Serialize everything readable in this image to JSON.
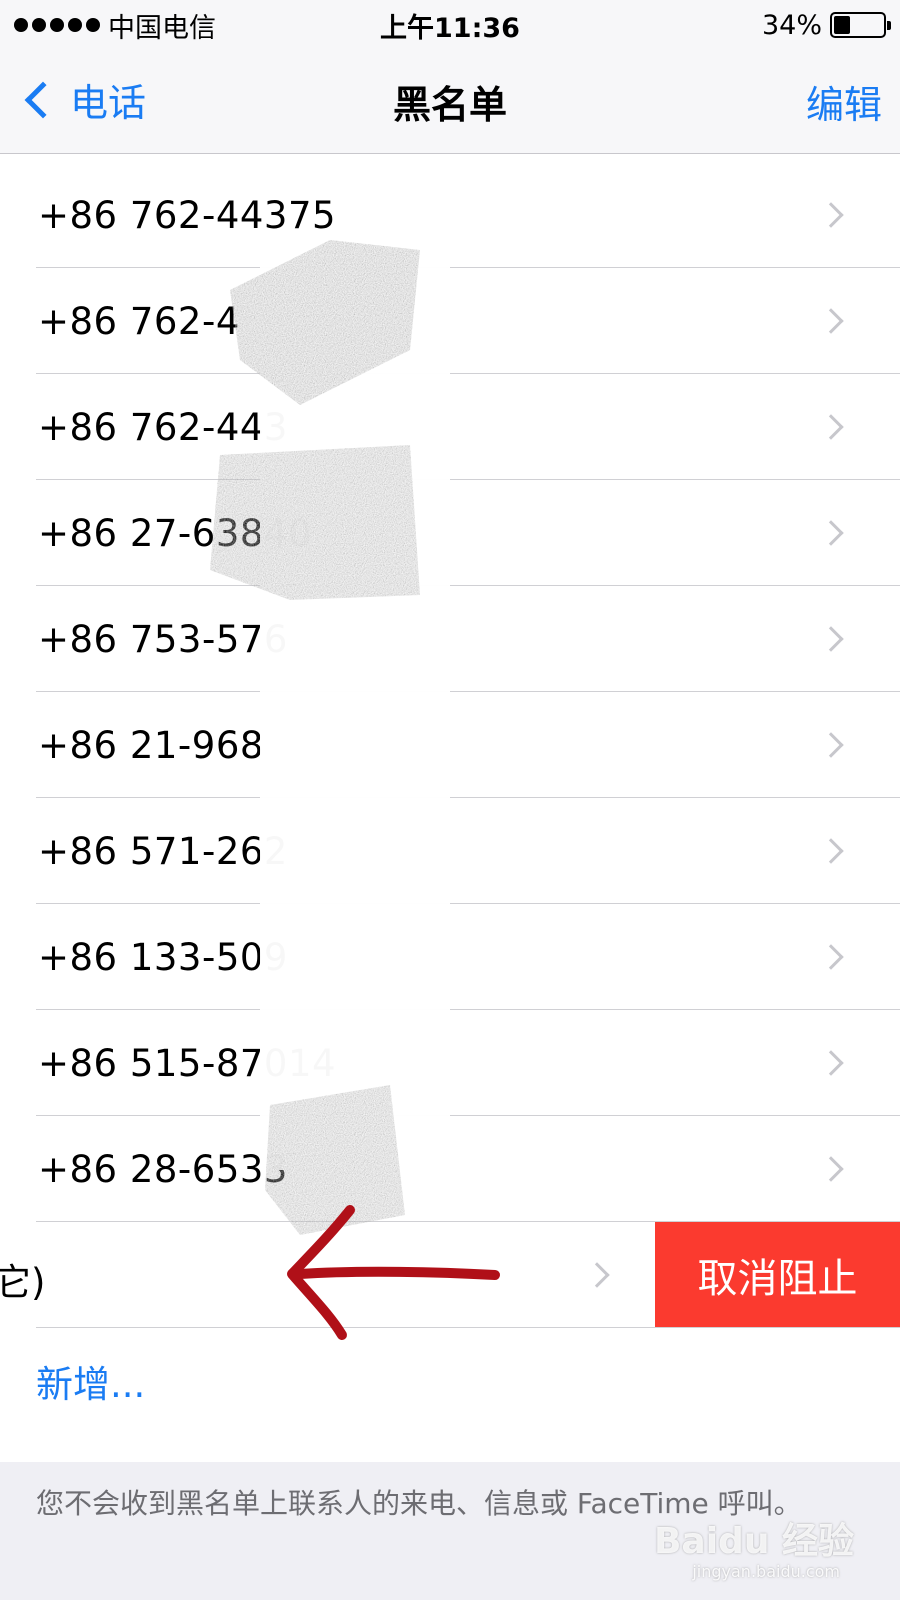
{
  "status_bar": {
    "carrier": "中国电信",
    "time": "上午11:36",
    "battery_percent": "34%",
    "battery_level": 0.34
  },
  "nav": {
    "back_label": "电话",
    "title": "黑名单",
    "edit_label": "编辑"
  },
  "blocked_numbers": [
    {
      "number": "+86 762-44375"
    },
    {
      "number": "+86 762-4"
    },
    {
      "number": "+86 762-443"
    },
    {
      "number": "+86 27-63840"
    },
    {
      "number": "+86 753-576"
    },
    {
      "number": "+86 21-968"
    },
    {
      "number": "+86 571-262"
    },
    {
      "number": "+86 133-509"
    },
    {
      "number": "+86 515-87014"
    },
    {
      "number": "+86 28-6533"
    }
  ],
  "swiped_row": {
    "partial_text": "它)",
    "action_label": "取消阻止",
    "action_color": "#fb3a2f"
  },
  "add_label": "新增...",
  "footer_text": "您不会收到黑名单上联系人的来电、信息或 FaceTime 呼叫。",
  "watermark": {
    "text": "Baidu 经验",
    "url": "jingyan.baidu.com"
  },
  "colors": {
    "accent": "#1a7cf3",
    "destructive": "#fb3a2f",
    "annotation": "#b01018"
  }
}
